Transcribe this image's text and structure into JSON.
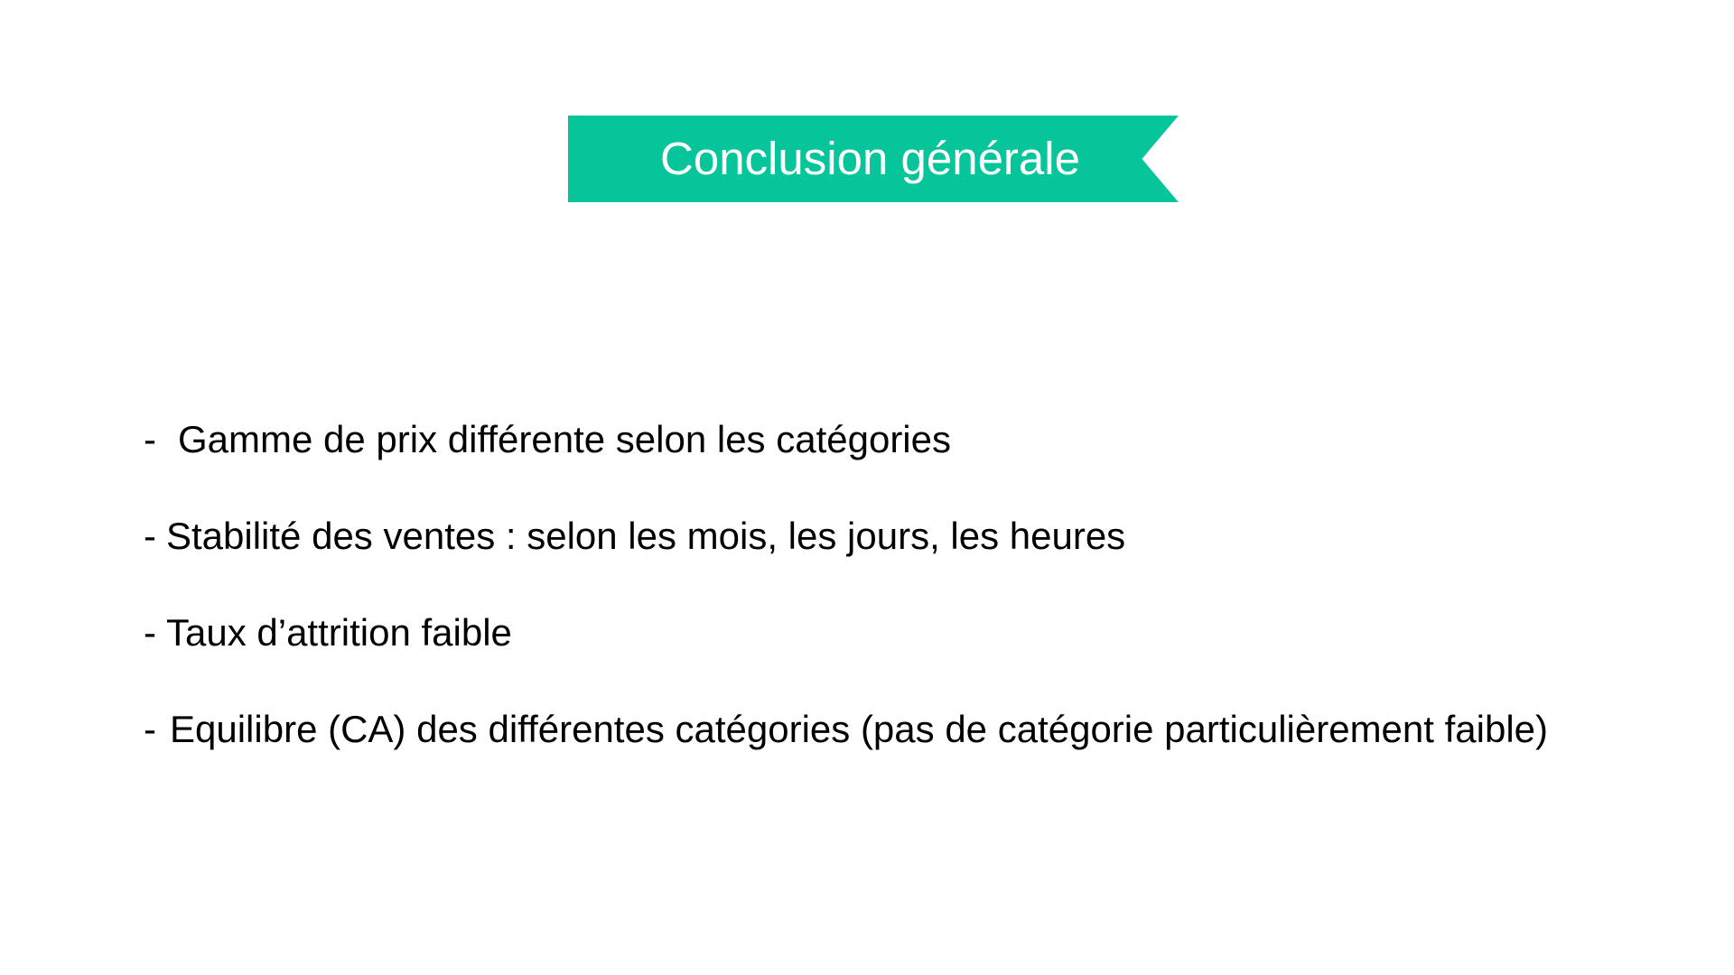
{
  "slide": {
    "title": "Conclusion générale",
    "accent_color": "#06C59B",
    "bullets": [
      {
        "marker": "-",
        "text": "Gamme de prix différente selon les catégories"
      },
      {
        "marker": "-",
        "text": "Stabilité des ventes : selon les mois, les jours, les heures"
      },
      {
        "marker": "-",
        "text": "Taux d’attrition faible"
      },
      {
        "marker": "-",
        "text": "Equilibre (CA) des différentes catégories (pas de catégorie particulièrement faible)"
      }
    ]
  }
}
